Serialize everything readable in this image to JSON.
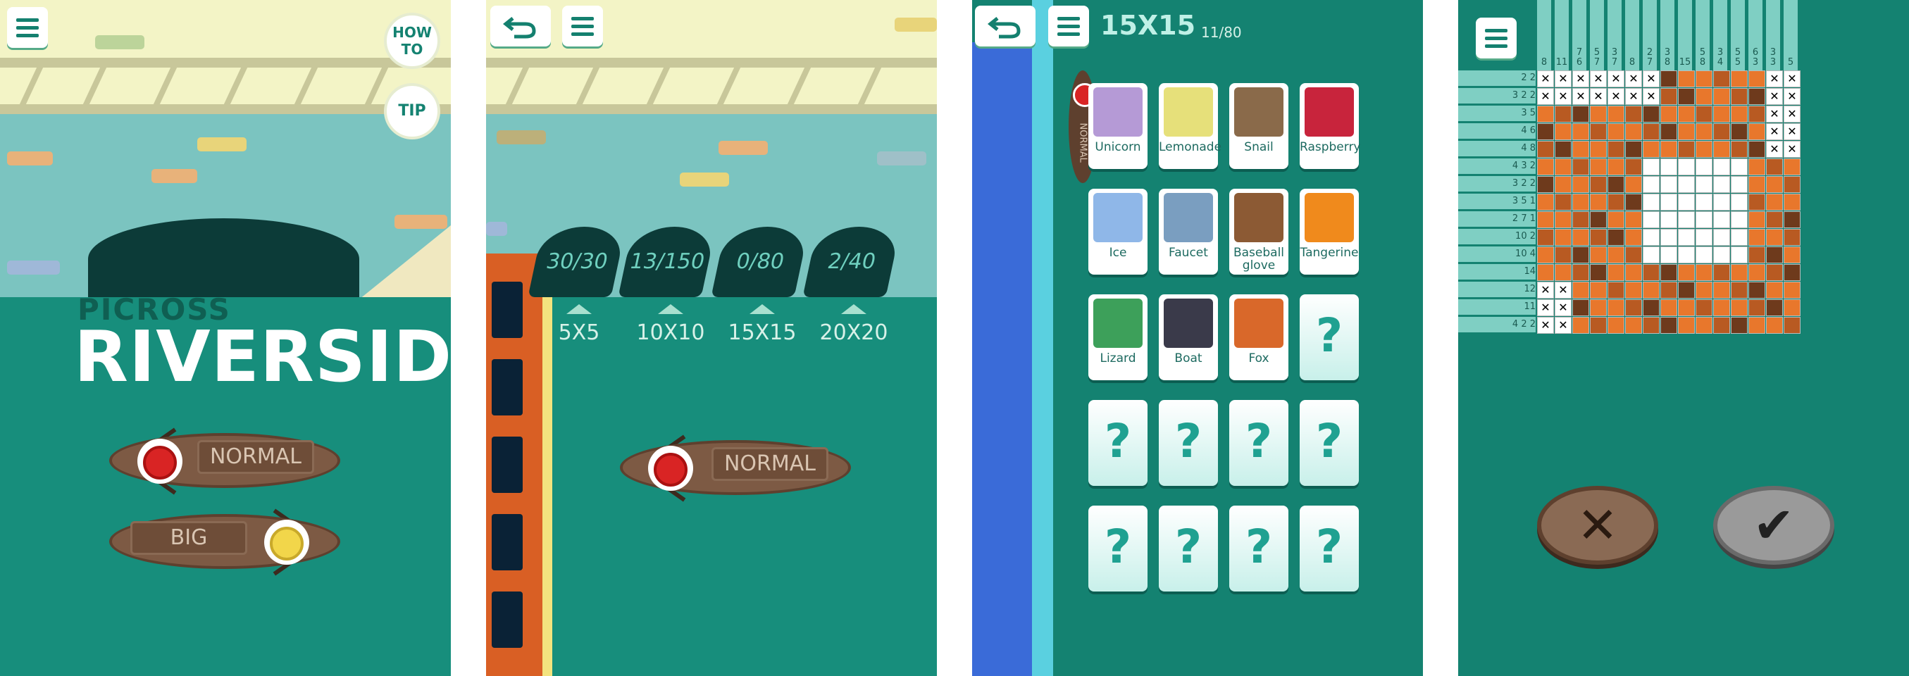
{
  "screen1": {
    "howto_label": "HOW\nTO",
    "tip_label": "TIP",
    "title_small": "PICROSS",
    "title_big": "RIVERSIDE",
    "mode_normal": "NORMAL",
    "mode_big": "BIG"
  },
  "screen2": {
    "stages": [
      {
        "progress": "30/30",
        "label": "5X5"
      },
      {
        "progress": "13/150",
        "label": "10X10"
      },
      {
        "progress": "0/80",
        "label": "15X15"
      },
      {
        "progress": "2/40",
        "label": "20X20"
      }
    ],
    "mode": "NORMAL"
  },
  "screen3": {
    "size_title": "15X15",
    "count": "11/80",
    "side_label": "NORMAL",
    "puzzles": [
      {
        "name": "Unicorn",
        "color": "#b59ad6"
      },
      {
        "name": "Lemonade",
        "color": "#e6e07a"
      },
      {
        "name": "Snail",
        "color": "#8a6a4a"
      },
      {
        "name": "Raspberry",
        "color": "#c8243c"
      },
      {
        "name": "Ice",
        "color": "#8fb7e8"
      },
      {
        "name": "Faucet",
        "color": "#7a9ec0"
      },
      {
        "name": "Baseball glove",
        "color": "#8c5a34"
      },
      {
        "name": "Tangerine",
        "color": "#f08a1c"
      },
      {
        "name": "Lizard",
        "color": "#3da05a"
      },
      {
        "name": "Boat",
        "color": "#3a3a4a"
      },
      {
        "name": "Fox",
        "color": "#d9682a"
      },
      {
        "name": "",
        "color": ""
      },
      {
        "name": "",
        "color": ""
      },
      {
        "name": "",
        "color": ""
      },
      {
        "name": "",
        "color": ""
      },
      {
        "name": "",
        "color": ""
      },
      {
        "name": "",
        "color": ""
      },
      {
        "name": "",
        "color": ""
      },
      {
        "name": "",
        "color": ""
      },
      {
        "name": "",
        "color": ""
      }
    ],
    "unknown_mark": "?"
  },
  "screen4": {
    "col_clues": [
      "8",
      "11",
      "7 6",
      "5 7",
      "3 7",
      "8",
      "2 7",
      "3 8",
      "15",
      "5 8",
      "3 4",
      "5 5",
      "6 3",
      "3 3",
      "5"
    ],
    "row_clues": [
      "2 2",
      "3 2 2",
      "3 5",
      "4 6",
      "4 8",
      "4 3 2",
      "3 2 2",
      "3 5 1",
      "2 7 1",
      "10 2",
      "10 4",
      "14",
      "12",
      "11",
      "4 2 2"
    ],
    "x_mark": "✕",
    "check_mark": "✔"
  }
}
